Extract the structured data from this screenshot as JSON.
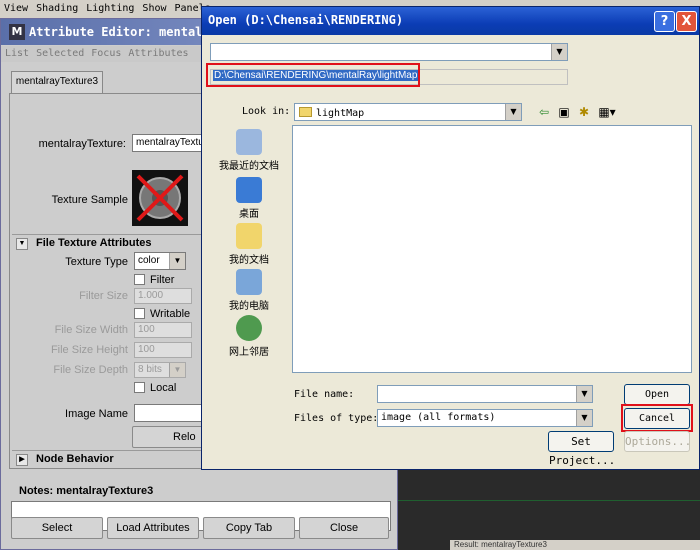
{
  "maya_menu": [
    "View",
    "Shading",
    "Lighting",
    "Show",
    "Panels"
  ],
  "attribute_editor": {
    "title": "Attribute Editor: mentalr",
    "menu": [
      "List",
      "Selected",
      "Focus",
      "Attributes"
    ],
    "tab": "mentalrayTexture3",
    "node_label": "mentalrayTexture:",
    "node_value": "mentalrayTexture",
    "texture_sample_label": "Texture Sample",
    "section_file": "File Texture Attributes",
    "texture_type_label": "Texture Type",
    "texture_type_value": "color",
    "filter_label": "Filter",
    "filter_size_label": "Filter Size",
    "filter_size_value": "1.000",
    "writable_label": "Writable",
    "file_size_width_label": "File Size Width",
    "file_size_width_value": "100",
    "file_size_height_label": "File Size Height",
    "file_size_height_value": "100",
    "file_size_depth_label": "File Size Depth",
    "file_size_depth_value": "8 bits",
    "local_label": "Local",
    "image_name_label": "Image Name",
    "reload_label": "Relo",
    "section_node": "Node Behavior",
    "notes_label": "Notes: mentalrayTexture3",
    "buttons": {
      "select": "Select",
      "load_attributes": "Load Attributes",
      "copy_tab": "Copy Tab",
      "close": "Close"
    }
  },
  "open_dialog": {
    "title": "Open (D:\\Chensai\\RENDERING)",
    "help_btn": "?",
    "close_btn": "X",
    "path": "D:\\Chensai\\RENDERING\\mentalRay\\lightMap",
    "look_in_label": "Look in:",
    "look_in_value": "lightMap",
    "places": [
      "我最近的文档",
      "桌面",
      "我的文档",
      "我的电脑",
      "网上邻居"
    ],
    "file_name_label": "File name:",
    "file_name_value": "",
    "files_of_type_label": "Files of type:",
    "files_of_type_value": "image (all formats)",
    "open_btn": "Open",
    "cancel_btn": "Cancel",
    "set_project_btn": "Set Project...",
    "options_btn": "Options..."
  },
  "status_fragment": "Result: mentalrayTexture3",
  "colors": {
    "dialog_title": "#0b3db5",
    "highlight": "#e0101a",
    "selection": "#316ac5"
  }
}
